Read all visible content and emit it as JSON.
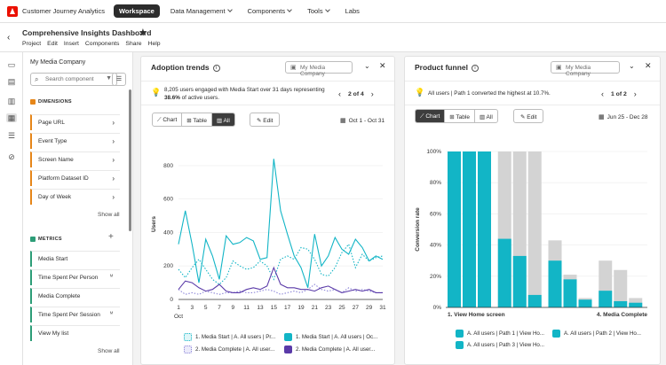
{
  "topbar": {
    "app_name": "Customer Journey Analytics",
    "nav": [
      {
        "label": "Workspace",
        "active": true
      },
      {
        "label": "Data Management",
        "caret": true
      },
      {
        "label": "Components",
        "caret": true
      },
      {
        "label": "Tools",
        "caret": true
      },
      {
        "label": "Labs"
      }
    ]
  },
  "project": {
    "title": "Comprehensive Insights Dashboard",
    "menu": [
      "Project",
      "Edit",
      "Insert",
      "Components",
      "Share",
      "Help"
    ]
  },
  "left_panel": {
    "company": "My Media Company",
    "search_placeholder": "Search component",
    "dimensions_label": "DIMENSIONS",
    "dimensions": [
      "Page URL",
      "Event Type",
      "Screen Name",
      "Platform Dataset ID",
      "Day of Week"
    ],
    "metrics_label": "METRICS",
    "metrics": [
      "Media Start",
      "Time Spent Per Person",
      "Media Complete",
      "Time Spent Per Session",
      "View My list"
    ],
    "show_all": "Show all"
  },
  "adoption": {
    "title": "Adoption trends",
    "company": "My Media Company",
    "insight_line1": "8,205 users engaged with Media Start over 31 days representing",
    "insight_bold": "38.6%",
    "insight_rest": " of active users.",
    "page": "2 of 4",
    "tabs": [
      "Chart",
      "Table",
      "All"
    ],
    "edit": "Edit",
    "date_range": "Oct 1 - Oct 31",
    "legend": [
      "1. Media Start | A. All users | Pr...",
      "1. Media Start | A. All users | Oc...",
      "2. Media Complete | A. All user...",
      "2. Media Complete | A. All user..."
    ]
  },
  "funnel": {
    "title": "Product funnel",
    "company": "My Media Company",
    "insight": "All users | Path 1 converted the highest at 10.7%.",
    "page": "1 of 2",
    "tabs": [
      "Chart",
      "Table",
      "All"
    ],
    "edit": "Edit",
    "date_range": "Jun 25 - Dec 28",
    "legend": [
      "A. All users | Path 1 | View Ho...",
      "A. All users | Path 2 | View Ho...",
      "A. All users | Path 3 | View Ho..."
    ]
  },
  "colors": {
    "teal": "#12b5c6",
    "purple": "#5a3aa8",
    "lavender": "#8d86d8",
    "gray_bar": "#d3d3d3"
  },
  "chart_data": [
    {
      "type": "line",
      "title": "Adoption trends",
      "xlabel": "",
      "ylabel": "Users",
      "x": [
        1,
        2,
        3,
        4,
        5,
        6,
        7,
        8,
        9,
        10,
        11,
        12,
        13,
        14,
        15,
        16,
        17,
        18,
        19,
        20,
        21,
        22,
        23,
        24,
        25,
        26,
        27,
        28,
        29,
        30,
        31
      ],
      "xticks": [
        "1",
        "3",
        "5",
        "7",
        "9",
        "11",
        "13",
        "15",
        "17",
        "19",
        "21",
        "23",
        "25",
        "27",
        "29",
        "31"
      ],
      "x_first_sublabel": "Oct",
      "yticks": [
        "0",
        "200",
        "400",
        "600",
        "800"
      ],
      "ylim": [
        0,
        900
      ],
      "series": [
        {
          "name": "1. Media Start | A. All users | Pr...",
          "style": "solid",
          "color": "#12b5c6",
          "values": [
            330,
            530,
            330,
            100,
            360,
            260,
            120,
            380,
            330,
            340,
            370,
            350,
            240,
            250,
            840,
            530,
            390,
            260,
            190,
            70,
            390,
            200,
            260,
            370,
            300,
            270,
            360,
            310,
            230,
            260,
            240
          ]
        },
        {
          "name": "1. Media Start | A. All users | Oc...",
          "style": "dotted",
          "color": "#12b5c6",
          "values": [
            180,
            130,
            190,
            240,
            180,
            120,
            90,
            130,
            230,
            200,
            180,
            190,
            230,
            200,
            120,
            240,
            260,
            240,
            310,
            300,
            240,
            150,
            140,
            190,
            280,
            330,
            190,
            270,
            230,
            250,
            260
          ]
        },
        {
          "name": "2. Media Complete | A. All user...",
          "style": "dotted",
          "color": "#8d86d8",
          "values": [
            60,
            30,
            40,
            30,
            50,
            40,
            30,
            40,
            40,
            50,
            40,
            40,
            50,
            60,
            50,
            30,
            40,
            50,
            40,
            60,
            90,
            60,
            50,
            60,
            40,
            70,
            50,
            60,
            50,
            40,
            40
          ]
        },
        {
          "name": "2. Media Complete | A. All user...",
          "style": "solid",
          "color": "#5a3aa8",
          "values": [
            60,
            110,
            100,
            70,
            50,
            60,
            90,
            50,
            40,
            40,
            60,
            70,
            60,
            80,
            190,
            90,
            70,
            70,
            60,
            60,
            50,
            70,
            80,
            60,
            40,
            50,
            60,
            50,
            60,
            40,
            40
          ]
        }
      ]
    },
    {
      "type": "bar",
      "title": "Product funnel",
      "xlabel": "",
      "ylabel": "Conversion rate",
      "categories": [
        "1. View Home screen",
        "",
        "",
        "4. Media Complete"
      ],
      "yticks": [
        "0%",
        "20%",
        "40%",
        "60%",
        "80%",
        "100%"
      ],
      "ylim": [
        0,
        100
      ],
      "series": [
        {
          "name": "A. All users | Path 1 | View Ho...",
          "values": [
            100,
            44,
            30,
            10.7
          ],
          "total": [
            100,
            100,
            43,
            30
          ]
        },
        {
          "name": "A. All users | Path 2 | View Ho...",
          "values": [
            100,
            33,
            18,
            4
          ],
          "total": [
            100,
            100,
            21,
            24
          ]
        },
        {
          "name": "A. All users | Path 3 | View Ho...",
          "values": [
            100,
            8,
            5,
            3
          ],
          "total": [
            100,
            100,
            6,
            6
          ]
        }
      ]
    }
  ]
}
